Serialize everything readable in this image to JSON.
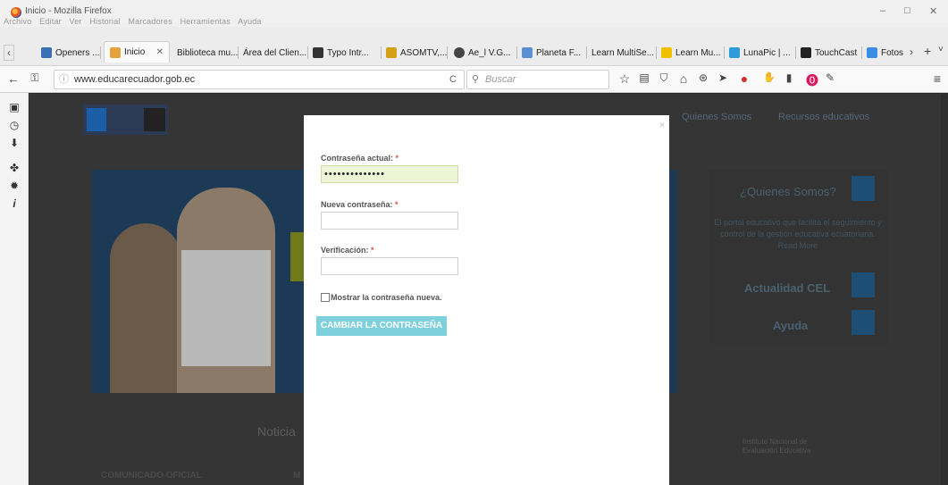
{
  "window": {
    "title": "Inicio - Mozilla Firefox",
    "menu": [
      "Archivo",
      "Editar",
      "Ver",
      "Historial",
      "Marcadores",
      "Herramientas",
      "Ayuda"
    ],
    "controls": [
      "–",
      "□",
      "✕"
    ]
  },
  "tabs": [
    {
      "label": "Openers ...",
      "icon_color": "#3b6fb6"
    },
    {
      "label": "Inicio",
      "icon_color": "#e6a23c",
      "active": true
    },
    {
      "label": "Biblioteca mu...",
      "icon_color": ""
    },
    {
      "label": "Área del Clien...",
      "icon_color": ""
    },
    {
      "label": "Typo Intr...",
      "icon_color": "#333333"
    },
    {
      "label": "ASOMTV,...",
      "icon_color": "#d4a017"
    },
    {
      "label": "Ae_l V.G...",
      "icon_color": "#444444"
    },
    {
      "label": "Planeta F...",
      "icon_color": "#5a8fd1"
    },
    {
      "label": "Learn MultiSe...",
      "icon_color": ""
    },
    {
      "label": "Learn Mu...",
      "icon_color": "#f0c000"
    },
    {
      "label": "LunaPic | ...",
      "icon_color": "#2d9cdb"
    },
    {
      "label": "TouchCast",
      "icon_color": "#222222"
    },
    {
      "label": "Fotos",
      "icon_color": "#3a8ee6"
    }
  ],
  "tab_close": "✕",
  "navbar": {
    "url": "www.educarecuador.gob.ec",
    "search_placeholder": "Buscar",
    "reload": "C"
  },
  "page": {
    "nav_links": [
      "Quienes Somos",
      "Recursos educativos"
    ],
    "sidebox": {
      "title": "¿Quienes Somos?",
      "text": "El portal educativo que facilita el seguimiento y control de la gestión educativa ecuatoriana. Read More",
      "actualidad": "Actualidad CEL",
      "ayuda": "Ayuda"
    },
    "noticias": "Noticia",
    "comunicado": "COMUNICADO OFICIAL",
    "m": "M",
    "ineval": "Instituto Nacional de Evaluación Educativa"
  },
  "modal": {
    "close": "×",
    "current_password_label": "Contraseña actual:",
    "current_password_value": "••••••••••••••",
    "new_password_label": "Nueva contraseña:",
    "new_password_value": "",
    "verification_label": "Verificación:",
    "verification_value": "",
    "required_mark": "*",
    "show_password_label": "Mostrar la contraseña nueva.",
    "submit_label": "CAMBIAR LA CONTRASEÑA"
  },
  "colors": {
    "submit_bg": "#7dd0dc",
    "filled_input_bg": "#eef5d6",
    "required": "#d9534f"
  }
}
